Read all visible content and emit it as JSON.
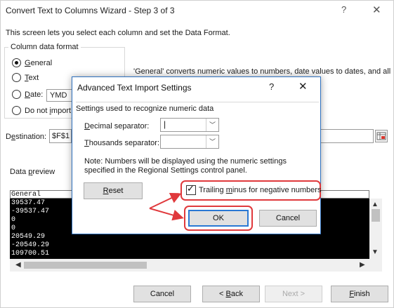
{
  "wizard": {
    "title": "Convert Text to Columns Wizard - Step 3 of 3",
    "help": "?",
    "close": "✕",
    "description": "This screen lets you select each column and set the Data Format.",
    "column_format": {
      "legend": "Column data format",
      "options": [
        {
          "pre": "",
          "key": "G",
          "post": "eneral",
          "selected": true
        },
        {
          "pre": "",
          "key": "T",
          "post": "ext",
          "selected": false
        },
        {
          "pre": "",
          "key": "D",
          "post": "ate:",
          "selected": false
        },
        {
          "pre": "Do not ",
          "key": "i",
          "post": "mport",
          "selected": false
        }
      ],
      "date_value": "YMD",
      "general_note": "'General' converts numeric values to numbers, date values to dates, and all"
    },
    "destination": {
      "label_pre": "D",
      "label_key": "e",
      "label_post": "stination:",
      "value": "$F$1"
    },
    "preview": {
      "label_pre": "Data ",
      "label_key": "p",
      "label_post": "review",
      "column_header": "General",
      "rows": [
        "39537.47",
        "-39537.47",
        "0",
        "0",
        "20549.29",
        "-20549.29",
        "109700.51"
      ]
    },
    "buttons": {
      "cancel": "Cancel",
      "back_pre": "< ",
      "back_key": "B",
      "back_post": "ack",
      "next": "Next >",
      "finish_key": "F",
      "finish_post": "inish"
    }
  },
  "dialog": {
    "title": "Advanced Text Import Settings",
    "help": "?",
    "close": "✕",
    "legend": "Settings used to recognize numeric data",
    "decimal_label_key": "D",
    "decimal_label_post": "ecimal separator:",
    "decimal_value": "|",
    "thousands_label_key": "T",
    "thousands_label_post": "housands separator:",
    "thousands_value": "",
    "note": "Note: Numbers will be displayed using the numeric settings specified in the Regional Settings control panel.",
    "reset_key": "R",
    "reset_post": "eset",
    "trailing_pre": "Trailing ",
    "trailing_key": "m",
    "trailing_post": "inus for negative numbers",
    "trailing_checked": true,
    "ok": "OK",
    "cancel": "Cancel"
  },
  "colors": {
    "annotation_red": "#e0393c",
    "dialog_border": "#2c6fbe",
    "preview_background": "#000000"
  }
}
